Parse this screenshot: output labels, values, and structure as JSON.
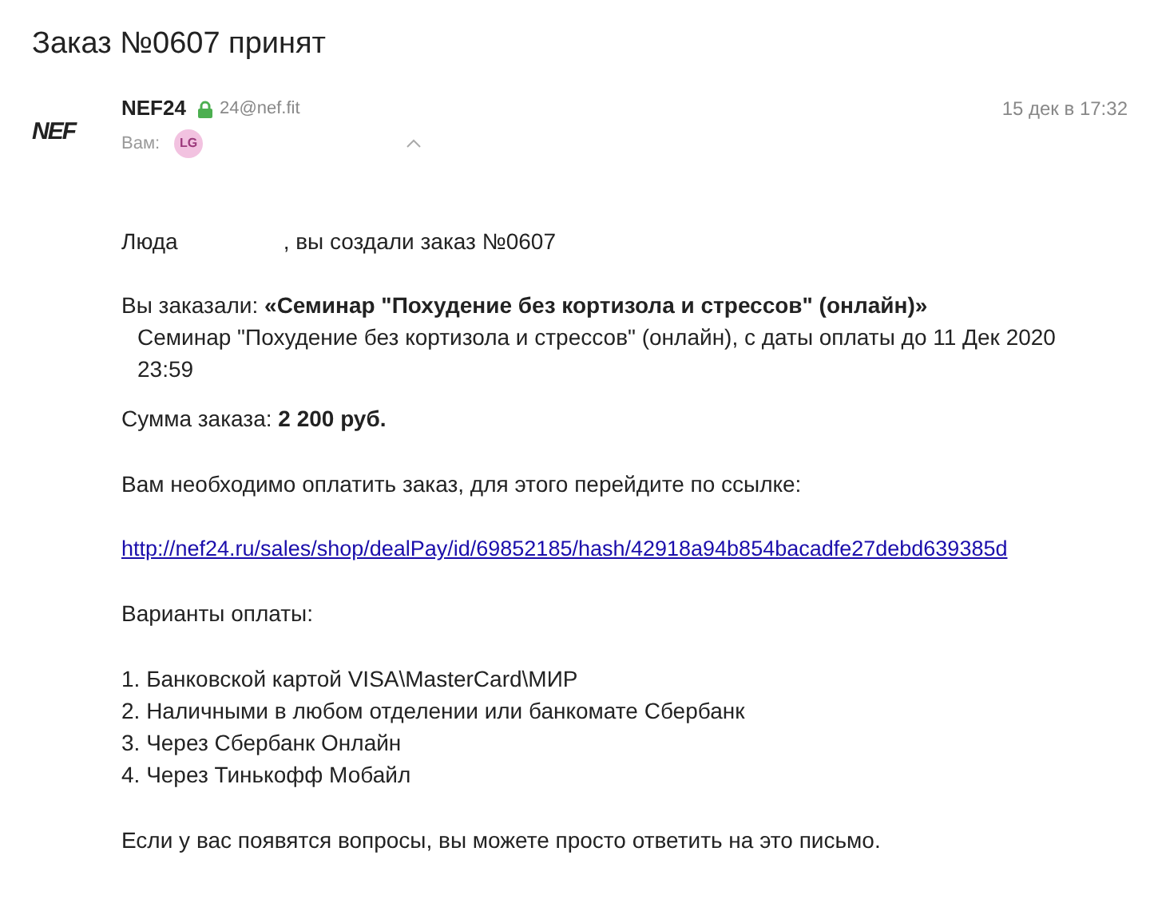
{
  "subject": "Заказ №0607 принят",
  "sender": {
    "logo": "NEF",
    "name": "NEF24",
    "secure": true,
    "email": "24@nef.fit",
    "date": "15 дек в 17:32",
    "to_label": "Вам:",
    "recipient_initials": "LG"
  },
  "body": {
    "greeting_name": "Люда",
    "greeting_rest": ", вы создали заказ №0607",
    "order_line": "Вы заказали: **«Семинар \"Похудение без кортизола и стрессов\" (онлайн)»**",
    "order_detail": "Семинар \"Похудение без кортизола и стрессов\" (онлайн), с даты оплаты до 11 Дек 2020 23:59",
    "sum_line": "Сумма заказа: **2 200 руб.**",
    "pay_prompt": "Вам необходимо оплатить заказ, для этого перейдите по ссылке:",
    "pay_link": "http://nef24.ru/sales/shop/dealPay/id/69852185/hash/42918a94b854bacadfe27debd639385d",
    "options_title": "Варианты оплаты:",
    "options": [
      "1. Банковской картой VISA\\MasterCard\\МИР",
      "2. Наличными в любом отделении или банкомате Сбербанк",
      "3. Через Сбербанк Онлайн",
      "4. Через Тинькофф Мобайл"
    ],
    "footer": "Если у вас появятся вопросы, вы можете просто ответить на это письмо."
  }
}
